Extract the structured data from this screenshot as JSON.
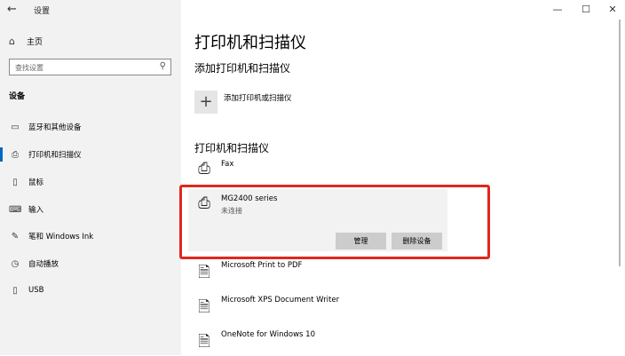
{
  "window": {
    "title": "设置",
    "back_glyph": "←",
    "minimize_glyph": "—",
    "maximize_glyph": "☐",
    "close_glyph": "✕"
  },
  "sidebar": {
    "home_label": "主页",
    "search_placeholder": "查找设置",
    "section_title": "设备",
    "items": [
      {
        "label": "蓝牙和其他设备",
        "icon": "bluetooth-icon"
      },
      {
        "label": "打印机和扫描仪",
        "icon": "printer-icon",
        "active": true
      },
      {
        "label": "鼠标",
        "icon": "mouse-icon"
      },
      {
        "label": "输入",
        "icon": "keyboard-icon"
      },
      {
        "label": "笔和 Windows Ink",
        "icon": "pen-icon"
      },
      {
        "label": "自动播放",
        "icon": "autoplay-icon"
      },
      {
        "label": "USB",
        "icon": "usb-icon"
      }
    ]
  },
  "main": {
    "title": "打印机和扫描仪",
    "add_section_title": "添加打印机和扫描仪",
    "add_label": "添加打印机或扫描仪",
    "devices_section_title": "打印机和扫描仪",
    "devices": [
      {
        "name": "Fax",
        "status": ""
      },
      {
        "name": "MG2400 series",
        "status": "未连接"
      },
      {
        "name": "Microsoft Print to PDF",
        "status": ""
      },
      {
        "name": "Microsoft XPS Document Writer",
        "status": ""
      },
      {
        "name": "OneNote for Windows 10",
        "status": ""
      }
    ],
    "manage_button": "管理",
    "remove_button": "删除设备"
  },
  "accent_color": "#0067c0",
  "highlight_color": "#e0281d"
}
